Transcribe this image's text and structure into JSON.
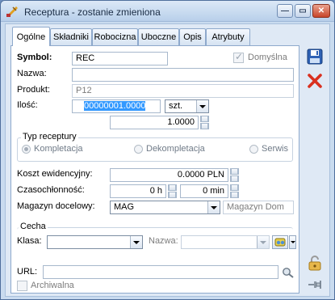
{
  "window": {
    "title": "Receptura - zostanie zmieniona",
    "min_glyph": "—",
    "max_glyph": "▭",
    "close_glyph": "✕"
  },
  "tabs": [
    "Ogólne",
    "Składniki",
    "Robocizna",
    "Uboczne",
    "Opis",
    "Atrybuty"
  ],
  "form": {
    "symbol_label": "Symbol:",
    "symbol_value": "REC",
    "domyslna_label": "Domyślna",
    "domyslna_checked": true,
    "nazwa_label": "Nazwa:",
    "nazwa_value": "",
    "produkt_label": "Produkt:",
    "produkt_value": "P12",
    "ilosc_label": "Ilość:",
    "ilosc_value": "00000001.0000",
    "unit_value": "szt.",
    "ilosc2_value": "1.0000",
    "typ_label": "Typ receptury",
    "typ_options": [
      "Kompletacja",
      "Dekompletacja",
      "Serwis"
    ],
    "typ_selected": "Kompletacja",
    "koszt_label": "Koszt ewidencyjny:",
    "koszt_value": "0.0000 PLN",
    "czas_label": "Czasochłonność:",
    "czas_hours": "0 h",
    "czas_minutes": "0 min",
    "magazyn_label": "Magazyn docelowy:",
    "magazyn_value": "MAG",
    "magazyn_name": "Magazyn Dom",
    "cecha_label": "Cecha",
    "klasa_label": "Klasa:",
    "klasa_value": "",
    "cecha_nazwa_label": "Nazwa:",
    "cecha_nazwa_value": "",
    "url_label": "URL:",
    "url_value": "",
    "archiwalna_label": "Archiwalna",
    "archiwalna_checked": false
  },
  "colors": {
    "window_frame": "#c9dbef",
    "accent_selection": "#3399ff",
    "delete_red": "#d9301f"
  }
}
